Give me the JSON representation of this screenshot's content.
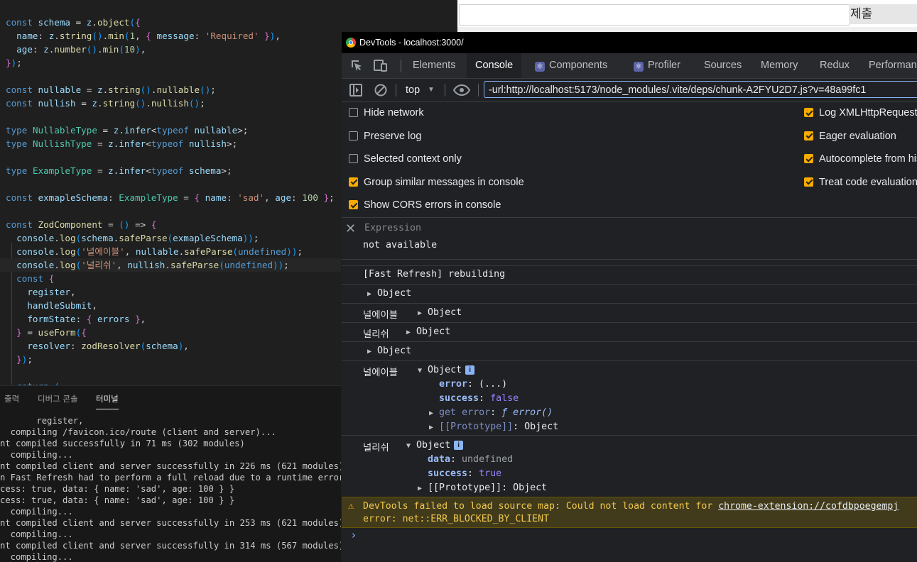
{
  "editor": {
    "lines": [
      [
        "const schema = z.object({"
      ],
      [
        "  name: z.string().min(1, { message: 'Required' }),"
      ],
      [
        "  age: z.number().min(10),"
      ],
      [
        "});"
      ],
      [
        ""
      ],
      [
        "const nullable = z.string().nullable();"
      ],
      [
        "const nullish = z.string().nullish();"
      ],
      [
        ""
      ],
      [
        "type NullableType = z.infer<typeof nullable>;"
      ],
      [
        "type NullishType = z.infer<typeof nullish>;"
      ],
      [
        ""
      ],
      [
        "type ExampleType = z.infer<typeof schema>;"
      ],
      [
        ""
      ],
      [
        "const exmapleSchema: ExampleType = { name: 'sad', age: 100 };"
      ],
      [
        ""
      ],
      [
        "const ZodComponent = () => {"
      ],
      [
        "  console.log(schema.safeParse(exmapleSchema));"
      ],
      [
        "  console.log('널에이블', nullable.safeParse(undefined));"
      ],
      [
        "  console.log('널리쉬', nullish.safeParse(undefined));"
      ],
      [
        "  const {"
      ],
      [
        "    register,"
      ],
      [
        "    handleSubmit,"
      ],
      [
        "    formState: { errors },"
      ],
      [
        "  } = useForm({"
      ],
      [
        "    resolver: zodResolver(schema),"
      ],
      [
        "  });"
      ],
      [
        ""
      ],
      [
        "  return ("
      ]
    ]
  },
  "panel": {
    "tabs": [
      "출력",
      "디버그 콘솔",
      "터미널"
    ],
    "terminal_lines": [
      "       register,",
      "  compiling /favicon.ico/route (client and server)...",
      "nt compiled successfully in 71 ms (302 modules)",
      "  compiling...",
      "nt compiled client and server successfully in 226 ms (621 modules)",
      "n Fast Refresh had to perform a full reload due to a runtime error.",
      "cess: true, data: { name: 'sad', age: 100 } }",
      "cess: true, data: { name: 'sad', age: 100 } }",
      "  compiling...",
      "nt compiled client and server successfully in 253 ms (621 modules)",
      "  compiling...",
      "nt compiled client and server successfully in 314 ms (567 modules)",
      "  compiling..."
    ]
  },
  "browser": {
    "submit_label": "제출"
  },
  "devtools": {
    "title": "DevTools - localhost:3000/",
    "tabs": [
      "Elements",
      "Console",
      "Components",
      "Profiler",
      "Sources",
      "Memory",
      "Redux",
      "Performan"
    ],
    "active_tab": "Console",
    "context": "top",
    "filter_value": "-url:http://localhost:5173/node_modules/.vite/deps/chunk-A2FYU2D7.js?v=48a99fc1",
    "settings_left": [
      {
        "label": "Hide network",
        "checked": false
      },
      {
        "label": "Preserve log",
        "checked": false
      },
      {
        "label": "Selected context only",
        "checked": false
      },
      {
        "label": "Group similar messages in console",
        "checked": true
      },
      {
        "label": "Show CORS errors in console",
        "checked": true
      }
    ],
    "settings_right": [
      {
        "label": "Log XMLHttpRequests",
        "checked": true
      },
      {
        "label": "Eager evaluation",
        "checked": true
      },
      {
        "label": "Autocomplete from history",
        "checked": true
      },
      {
        "label": "Treat code evaluation as user action",
        "checked": true
      }
    ],
    "expression_placeholder": "Expression",
    "expression_value": "not available",
    "messages": {
      "fast_refresh": "[Fast Refresh] rebuilding",
      "object": "Object",
      "nullable_label": "널에이블",
      "nullish_label": "널리쉬",
      "expanded1": {
        "error_key": "error",
        "error_val": "(...)",
        "success_key": "success",
        "success_val": "false",
        "getter_key": "get error",
        "getter_val": "ƒ error()",
        "proto_key": "[[Prototype]]",
        "proto_val": "Object"
      },
      "expanded2": {
        "data_key": "data",
        "data_val": "undefined",
        "success_key": "success",
        "success_val": "true",
        "proto_key": "[[Prototype]]",
        "proto_val": "Object"
      }
    },
    "warning": {
      "line1_prefix": "DevTools failed to load source map: Could not load content for ",
      "line1_link": "chrome-extension://cofdbpoegempj",
      "line2": "error: net::ERR_BLOCKED_BY_CLIENT"
    }
  }
}
